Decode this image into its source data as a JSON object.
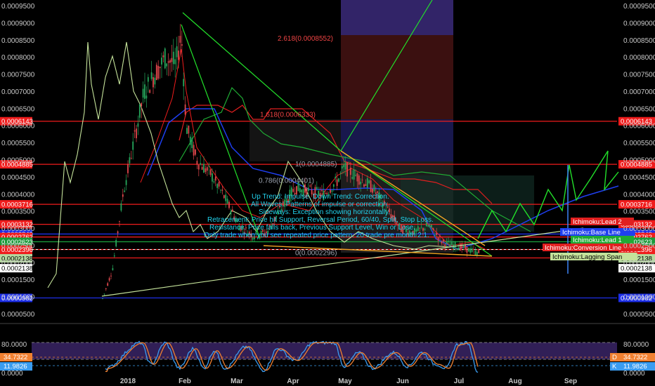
{
  "chart_data": {
    "type": "line",
    "price_scale": {
      "ylim": [
        5e-05,
        0.00097
      ],
      "ticks": [
        "0.0009500",
        "0.0009000",
        "0.0008500",
        "0.0008000",
        "0.0007500",
        "0.0007000",
        "0.0006500",
        "0.0006000",
        "0.0005500",
        "0.0005000",
        "0.0004500",
        "0.0004000",
        "0.0003500",
        "0.0003000",
        "0.0002500",
        "0.0002000",
        "0.0001500",
        "0.0001000",
        "0.0000500"
      ]
    },
    "time_axis": [
      "2018",
      "Feb",
      "Mar",
      "Apr",
      "May",
      "Jun",
      "Jul",
      "Aug",
      "Sep"
    ],
    "horizontal_levels": [
      {
        "value": 0.0006143,
        "label": "0.0006143",
        "color": "#ef1c1c"
      },
      {
        "value": 0.0004885,
        "label": "0.0004885",
        "color": "#ef1c1c"
      },
      {
        "value": 0.0003716,
        "label": "0.0003716",
        "color": "#ef1c1c"
      },
      {
        "value": 0.0003132,
        "label": "0.0003132",
        "color": "#ef1c1c"
      },
      {
        "value": 0.0002849,
        "label": "0.0002849",
        "color": "#1d2fe8"
      },
      {
        "value": 0.0002762,
        "label": "0.0002762",
        "color": "#ef1c1c"
      },
      {
        "value": 0.0002623,
        "label": "0.0002623",
        "color": "#1a9a3a"
      },
      {
        "value": 0.0002396,
        "label": "0.0002396",
        "color": "#ef1c1c"
      },
      {
        "value": 0.0002151,
        "label": "0.0002151",
        "color": "#ef1c1c"
      },
      {
        "value": 0.0002138,
        "label": "0.0002138",
        "color": "#b5d9a0"
      },
      {
        "value": 0.0002138,
        "label": "0.0002138",
        "color": "#ffffff"
      },
      {
        "value": 9.82e-05,
        "label": "0.0000982",
        "color": "#1d2fe8"
      }
    ],
    "fib_labels": [
      {
        "text": "2.618(0.0008552)",
        "value": 0.0008552
      },
      {
        "text": "1.618(0.0006333)",
        "value": 0.0006333
      },
      {
        "text": "1(0.0004885)",
        "value": 0.0004885
      },
      {
        "text": "0.786(0.0004401)",
        "value": 0.0004401
      },
      {
        "text": "0(0.0002296)",
        "value": 0.0002296
      }
    ],
    "ichimoku_tags": [
      "Ichimoku:Lead 2",
      "Ichimoku:Base Line",
      "Ichimoku:Lead 1",
      "Ichimoku:Conversion Line",
      "Ichimoku:Lagging Span"
    ],
    "annotation": [
      "Up Trend: Impulse, Down Trend: Correction.",
      "All Waves: Patterns of impulse or correction.",
      "Sideways: Exception showing horizontally.",
      "Retracement: Price hit Support, Reversal Period, 60/40, Split, Stop Loss.",
      "Resistance: Price falls back, Previous Support Level, Win or Lose.",
      "Only trade when you see repeated price pattern. 20 trade pre month 2:1."
    ],
    "oscillator": {
      "ylim": [
        0,
        100
      ],
      "ticks": [
        "80.0000",
        "0.0000"
      ],
      "d_value": "34.7322",
      "k_value": "11.9826",
      "d_label": "D",
      "k_label": "K",
      "upper_band": 80,
      "lower_band": 20
    }
  }
}
